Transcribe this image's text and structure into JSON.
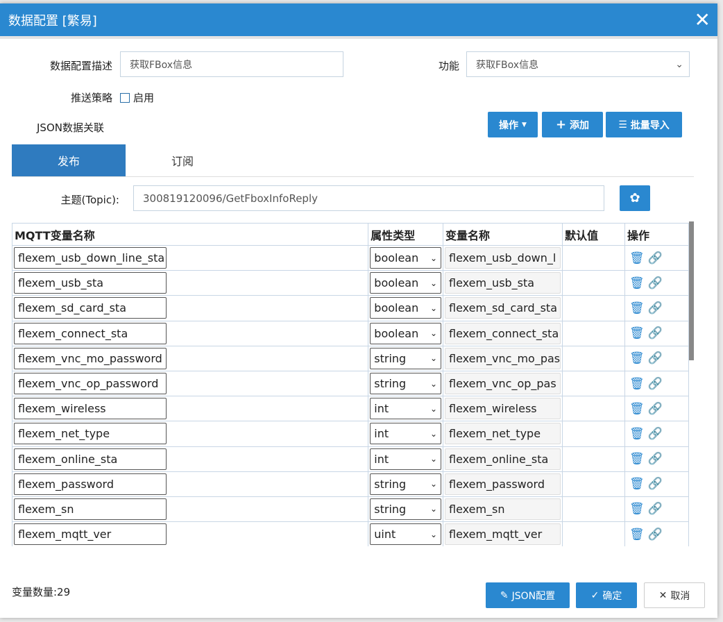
{
  "dialog": {
    "title": "数据配置 [繁易]",
    "close": "✕"
  },
  "form": {
    "desc_label": "数据配置描述",
    "desc_value": "获取FBox信息",
    "func_label": "功能",
    "func_value": "获取FBox信息",
    "push_label": "推送策略",
    "push_enable": "启用",
    "push_checked": false,
    "json_label": "JSON数据关联"
  },
  "toolbar": {
    "ops": "操作",
    "add": "添加",
    "import": "批量导入"
  },
  "tabs": [
    {
      "label": "发布",
      "active": true
    },
    {
      "label": "订阅",
      "active": false
    }
  ],
  "topic": {
    "label": "主题(Topic):",
    "value": "300819120096/GetFboxInfoReply"
  },
  "table": {
    "headers": [
      "MQTT变量名称",
      "属性类型",
      "变量名称",
      "默认值",
      "操作"
    ],
    "rows": [
      [
        "flexem_usb_down_line_sta",
        "boolean",
        "flexem_usb_down_l",
        ""
      ],
      [
        "flexem_usb_sta",
        "boolean",
        "flexem_usb_sta",
        ""
      ],
      [
        "flexem_sd_card_sta",
        "boolean",
        "flexem_sd_card_sta",
        ""
      ],
      [
        "flexem_connect_sta",
        "boolean",
        "flexem_connect_sta",
        ""
      ],
      [
        "flexem_vnc_mo_password",
        "string",
        "flexem_vnc_mo_pas",
        ""
      ],
      [
        "flexem_vnc_op_password",
        "string",
        "flexem_vnc_op_pas",
        ""
      ],
      [
        "flexem_wireless",
        "int",
        "flexem_wireless",
        ""
      ],
      [
        "flexem_net_type",
        "int",
        "flexem_net_type",
        ""
      ],
      [
        "flexem_online_sta",
        "int",
        "flexem_online_sta",
        ""
      ],
      [
        "flexem_password",
        "string",
        "flexem_password",
        ""
      ],
      [
        "flexem_sn",
        "string",
        "flexem_sn",
        ""
      ],
      [
        "flexem_mqtt_ver",
        "uint",
        "flexem_mqtt_ver",
        ""
      ]
    ]
  },
  "footer": {
    "count": "变量数量:29",
    "json_cfg": "JSON配置",
    "ok": "确定",
    "cancel": "取消"
  },
  "colors": {
    "primary": "#2a88d0"
  }
}
